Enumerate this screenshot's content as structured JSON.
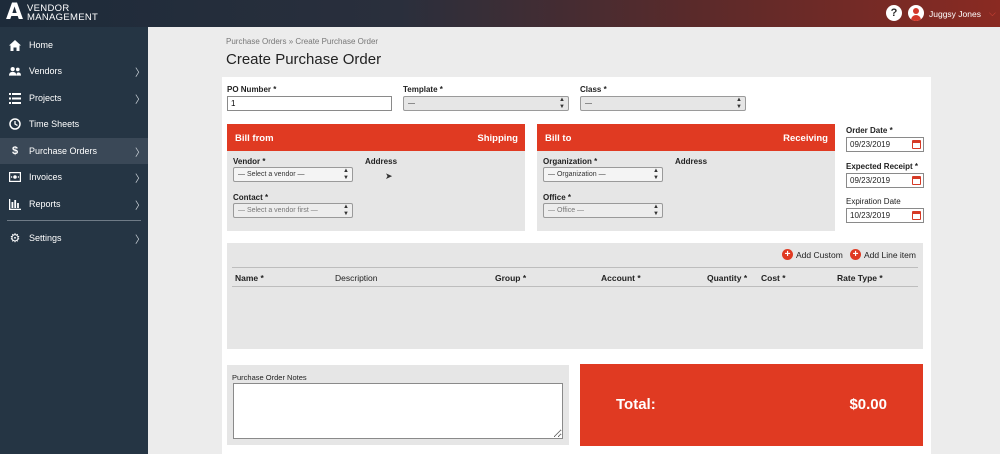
{
  "brand": {
    "line1": "VENDOR",
    "line2": "MANAGEMENT"
  },
  "header": {
    "help": "?",
    "user_name": "Juggsy Jones"
  },
  "sidebar": {
    "items": [
      {
        "label": "Home",
        "icon": "home-icon"
      },
      {
        "label": "Vendors",
        "icon": "users-icon"
      },
      {
        "label": "Projects",
        "icon": "list-icon"
      },
      {
        "label": "Time Sheets",
        "icon": "clock-icon"
      },
      {
        "label": "Purchase Orders",
        "icon": "dollar-icon",
        "active": true
      },
      {
        "label": "Invoices",
        "icon": "invoice-icon"
      },
      {
        "label": "Reports",
        "icon": "bar-chart-icon"
      },
      {
        "label": "Settings",
        "icon": "gear-icon"
      }
    ]
  },
  "breadcrumb": "Purchase Orders » Create Purchase Order",
  "page_title": "Create Purchase Order",
  "form": {
    "po_number_label": "PO Number *",
    "po_number_value": "1",
    "template_label": "Template *",
    "template_value": "—",
    "class_label": "Class *",
    "class_value": "—"
  },
  "bill_from": {
    "title": "Bill from",
    "right": "Shipping",
    "vendor_label": "Vendor *",
    "vendor_value": "— Select a vendor —",
    "address_label": "Address",
    "contact_label": "Contact *",
    "contact_value": "— Select a vendor first —"
  },
  "bill_to": {
    "title": "Bill to",
    "right": "Receiving",
    "org_label": "Organization *",
    "org_value": "— Organization —",
    "address_label": "Address",
    "office_label": "Office *",
    "office_value": "— Office —"
  },
  "dates": {
    "order_label": "Order Date *",
    "order_value": "09/23/2019",
    "expected_label": "Expected Receipt *",
    "expected_value": "09/23/2019",
    "expiration_label": "Expiration Date",
    "expiration_value": "10/23/2019"
  },
  "lines": {
    "add_custom": "Add Custom",
    "add_line_item": "Add Line item",
    "columns": [
      "Name *",
      "Description",
      "Group *",
      "Account *",
      "Quantity *",
      "Cost *",
      "Rate Type *"
    ]
  },
  "notes_label": "Purchase Order Notes",
  "total": {
    "label": "Total:",
    "value": "$0.00"
  },
  "colors": {
    "accent": "#e03a22",
    "sidebar": "#253544"
  }
}
